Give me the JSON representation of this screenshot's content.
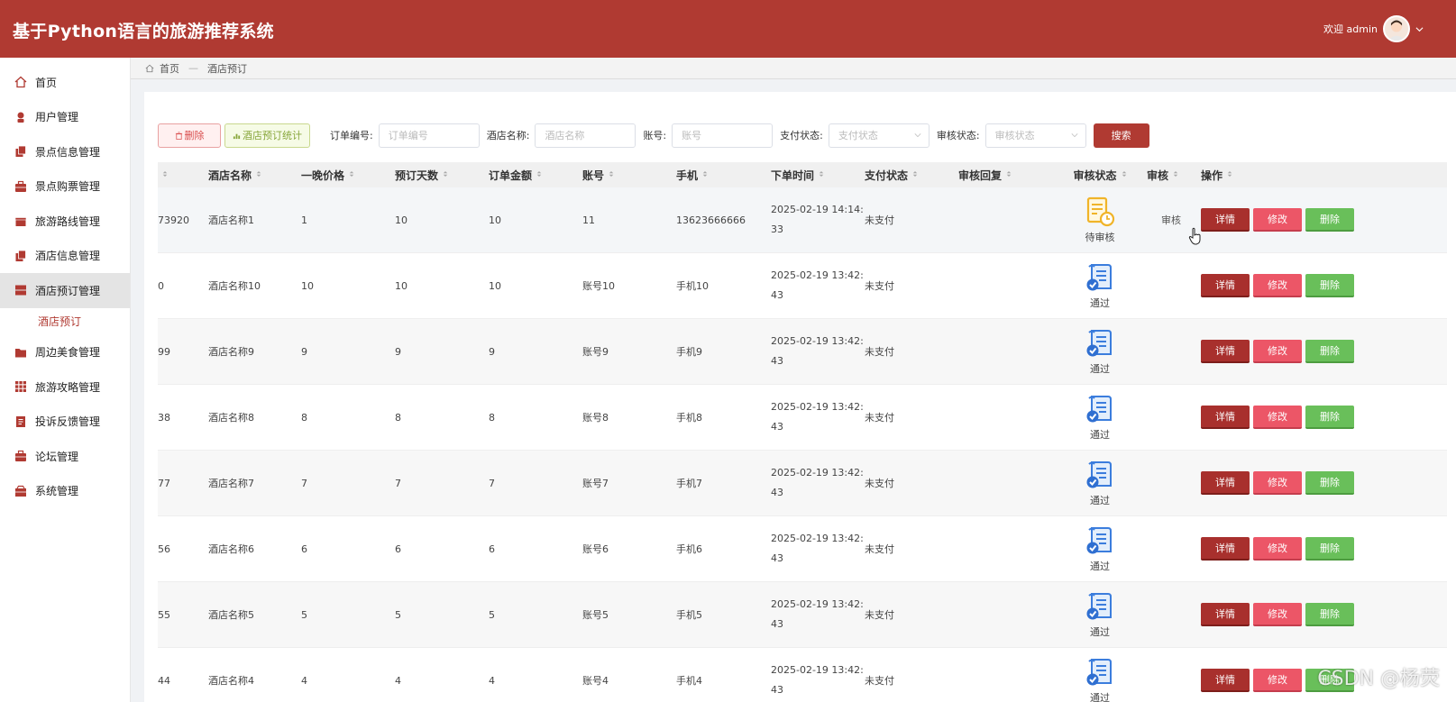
{
  "header": {
    "title": "基于Python语言的旅游推荐系统",
    "welcome": "欢迎 admin"
  },
  "sidebar": {
    "items": [
      {
        "label": "首页",
        "icon": "home-icon"
      },
      {
        "label": "用户管理",
        "icon": "user-icon"
      },
      {
        "label": "景点信息管理",
        "icon": "copy-icon"
      },
      {
        "label": "景点购票管理",
        "icon": "briefcase-icon"
      },
      {
        "label": "旅游路线管理",
        "icon": "gift-icon"
      },
      {
        "label": "酒店信息管理",
        "icon": "copy-icon"
      },
      {
        "label": "酒店预订管理",
        "icon": "server-icon"
      },
      {
        "label": "周边美食管理",
        "icon": "folder-icon"
      },
      {
        "label": "旅游攻略管理",
        "icon": "grid-icon"
      },
      {
        "label": "投诉反馈管理",
        "icon": "ticket-icon"
      },
      {
        "label": "论坛管理",
        "icon": "briefcase-icon"
      },
      {
        "label": "系统管理",
        "icon": "box-icon"
      }
    ],
    "submenu": {
      "label": "酒店预订"
    }
  },
  "breadcrumb": {
    "home": "首页",
    "separator": "—",
    "current": "酒店预订"
  },
  "toolbar": {
    "delete_label": "删除",
    "stat_label": "酒店预订统计",
    "order_no_label": "订单编号:",
    "order_no_placeholder": "订单编号",
    "hotel_name_label": "酒店名称:",
    "hotel_name_placeholder": "酒店名称",
    "account_label": "账号:",
    "account_placeholder": "账号",
    "pay_status_label": "支付状态:",
    "pay_status_placeholder": "支付状态",
    "review_status_label": "审核状态:",
    "review_status_placeholder": "审核状态",
    "search_label": "搜索"
  },
  "table": {
    "headers": [
      "",
      "酒店名称",
      "一晚价格",
      "预订天数",
      "订单金额",
      "账号",
      "手机",
      "下单时间",
      "支付状态",
      "审核回复",
      "审核状态",
      "审核",
      "操作"
    ],
    "rows": [
      {
        "order": "73920",
        "hotel": "酒店名称1",
        "price": "1",
        "days": "10",
        "amount": "10",
        "account": "11",
        "phone": "13623666666",
        "time1": "2025-02-19 14:14:",
        "time2": "33",
        "pay": "未支付",
        "reply": "",
        "status": "待审核",
        "status_type": "pending",
        "review": "审核"
      },
      {
        "order": "0",
        "hotel": "酒店名称10",
        "price": "10",
        "days": "10",
        "amount": "10",
        "account": "账号10",
        "phone": "手机10",
        "time1": "2025-02-19 13:42:",
        "time2": "43",
        "pay": "未支付",
        "reply": "",
        "status": "通过",
        "status_type": "pass",
        "review": ""
      },
      {
        "order": "99",
        "hotel": "酒店名称9",
        "price": "9",
        "days": "9",
        "amount": "9",
        "account": "账号9",
        "phone": "手机9",
        "time1": "2025-02-19 13:42:",
        "time2": "43",
        "pay": "未支付",
        "reply": "",
        "status": "通过",
        "status_type": "pass",
        "review": ""
      },
      {
        "order": "38",
        "hotel": "酒店名称8",
        "price": "8",
        "days": "8",
        "amount": "8",
        "account": "账号8",
        "phone": "手机8",
        "time1": "2025-02-19 13:42:",
        "time2": "43",
        "pay": "未支付",
        "reply": "",
        "status": "通过",
        "status_type": "pass",
        "review": ""
      },
      {
        "order": "77",
        "hotel": "酒店名称7",
        "price": "7",
        "days": "7",
        "amount": "7",
        "account": "账号7",
        "phone": "手机7",
        "time1": "2025-02-19 13:42:",
        "time2": "43",
        "pay": "未支付",
        "reply": "",
        "status": "通过",
        "status_type": "pass",
        "review": ""
      },
      {
        "order": "56",
        "hotel": "酒店名称6",
        "price": "6",
        "days": "6",
        "amount": "6",
        "account": "账号6",
        "phone": "手机6",
        "time1": "2025-02-19 13:42:",
        "time2": "43",
        "pay": "未支付",
        "reply": "",
        "status": "通过",
        "status_type": "pass",
        "review": ""
      },
      {
        "order": "55",
        "hotel": "酒店名称5",
        "price": "5",
        "days": "5",
        "amount": "5",
        "account": "账号5",
        "phone": "手机5",
        "time1": "2025-02-19 13:42:",
        "time2": "43",
        "pay": "未支付",
        "reply": "",
        "status": "通过",
        "status_type": "pass",
        "review": ""
      },
      {
        "order": "44",
        "hotel": "酒店名称4",
        "price": "4",
        "days": "4",
        "amount": "4",
        "account": "账号4",
        "phone": "手机4",
        "time1": "2025-02-19 13:42:",
        "time2": "43",
        "pay": "未支付",
        "reply": "",
        "status": "通过",
        "status_type": "pass",
        "review": ""
      }
    ],
    "ops": {
      "detail": "详情",
      "edit": "修改",
      "delete": "删除"
    }
  },
  "watermark": "CSDN @杨荧",
  "colors": {
    "brand": "#b03a32",
    "edit": "#ec5667",
    "delete": "#69bf5a"
  }
}
